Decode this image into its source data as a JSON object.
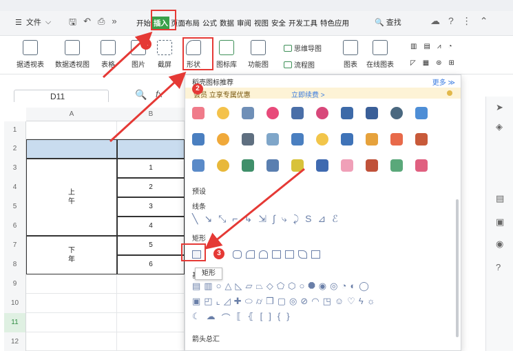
{
  "menu": {
    "file_label": "文件",
    "search_label": "查找"
  },
  "tabs": [
    "开始",
    "插入",
    "页面布局",
    "公式",
    "数据",
    "审阅",
    "视图",
    "安全",
    "开发工具",
    "特色应用"
  ],
  "ribbon": {
    "items": [
      "据透视表",
      "数据透视图",
      "表格",
      "图片",
      "截屏",
      "形状",
      "图标库",
      "功能图",
      "图表",
      "在线图表"
    ],
    "small_items": [
      "思维导图",
      "流程图"
    ]
  },
  "formula_bar": {
    "cell_ref": "D11",
    "fx_label": "fx"
  },
  "grid": {
    "col_headers": [
      "A",
      "B"
    ],
    "row_numbers": [
      "1",
      "2",
      "3",
      "4",
      "5",
      "6",
      "7",
      "8",
      "9",
      "10",
      "11",
      "12"
    ],
    "label_am": "上\n午",
    "label_pm": "下\n年",
    "numbers": [
      "1",
      "2",
      "3",
      "4",
      "5",
      "6"
    ]
  },
  "dropdown": {
    "title": "稻壳图标推荐",
    "more_label": "更多 ≫",
    "vip_text": "会员 立享专属优惠",
    "vip_link": "立即续费 >",
    "sections": {
      "preset": "预设",
      "lines": "线条",
      "rect": "矩形",
      "basic": "基",
      "arrows": "箭头总汇"
    },
    "tooltip": "矩形"
  },
  "badges": [
    "1",
    "2",
    "3"
  ],
  "colors": {
    "accent": "#3aa04a",
    "annotation": "#e53935",
    "vip_bg": "#fdf3d6"
  }
}
